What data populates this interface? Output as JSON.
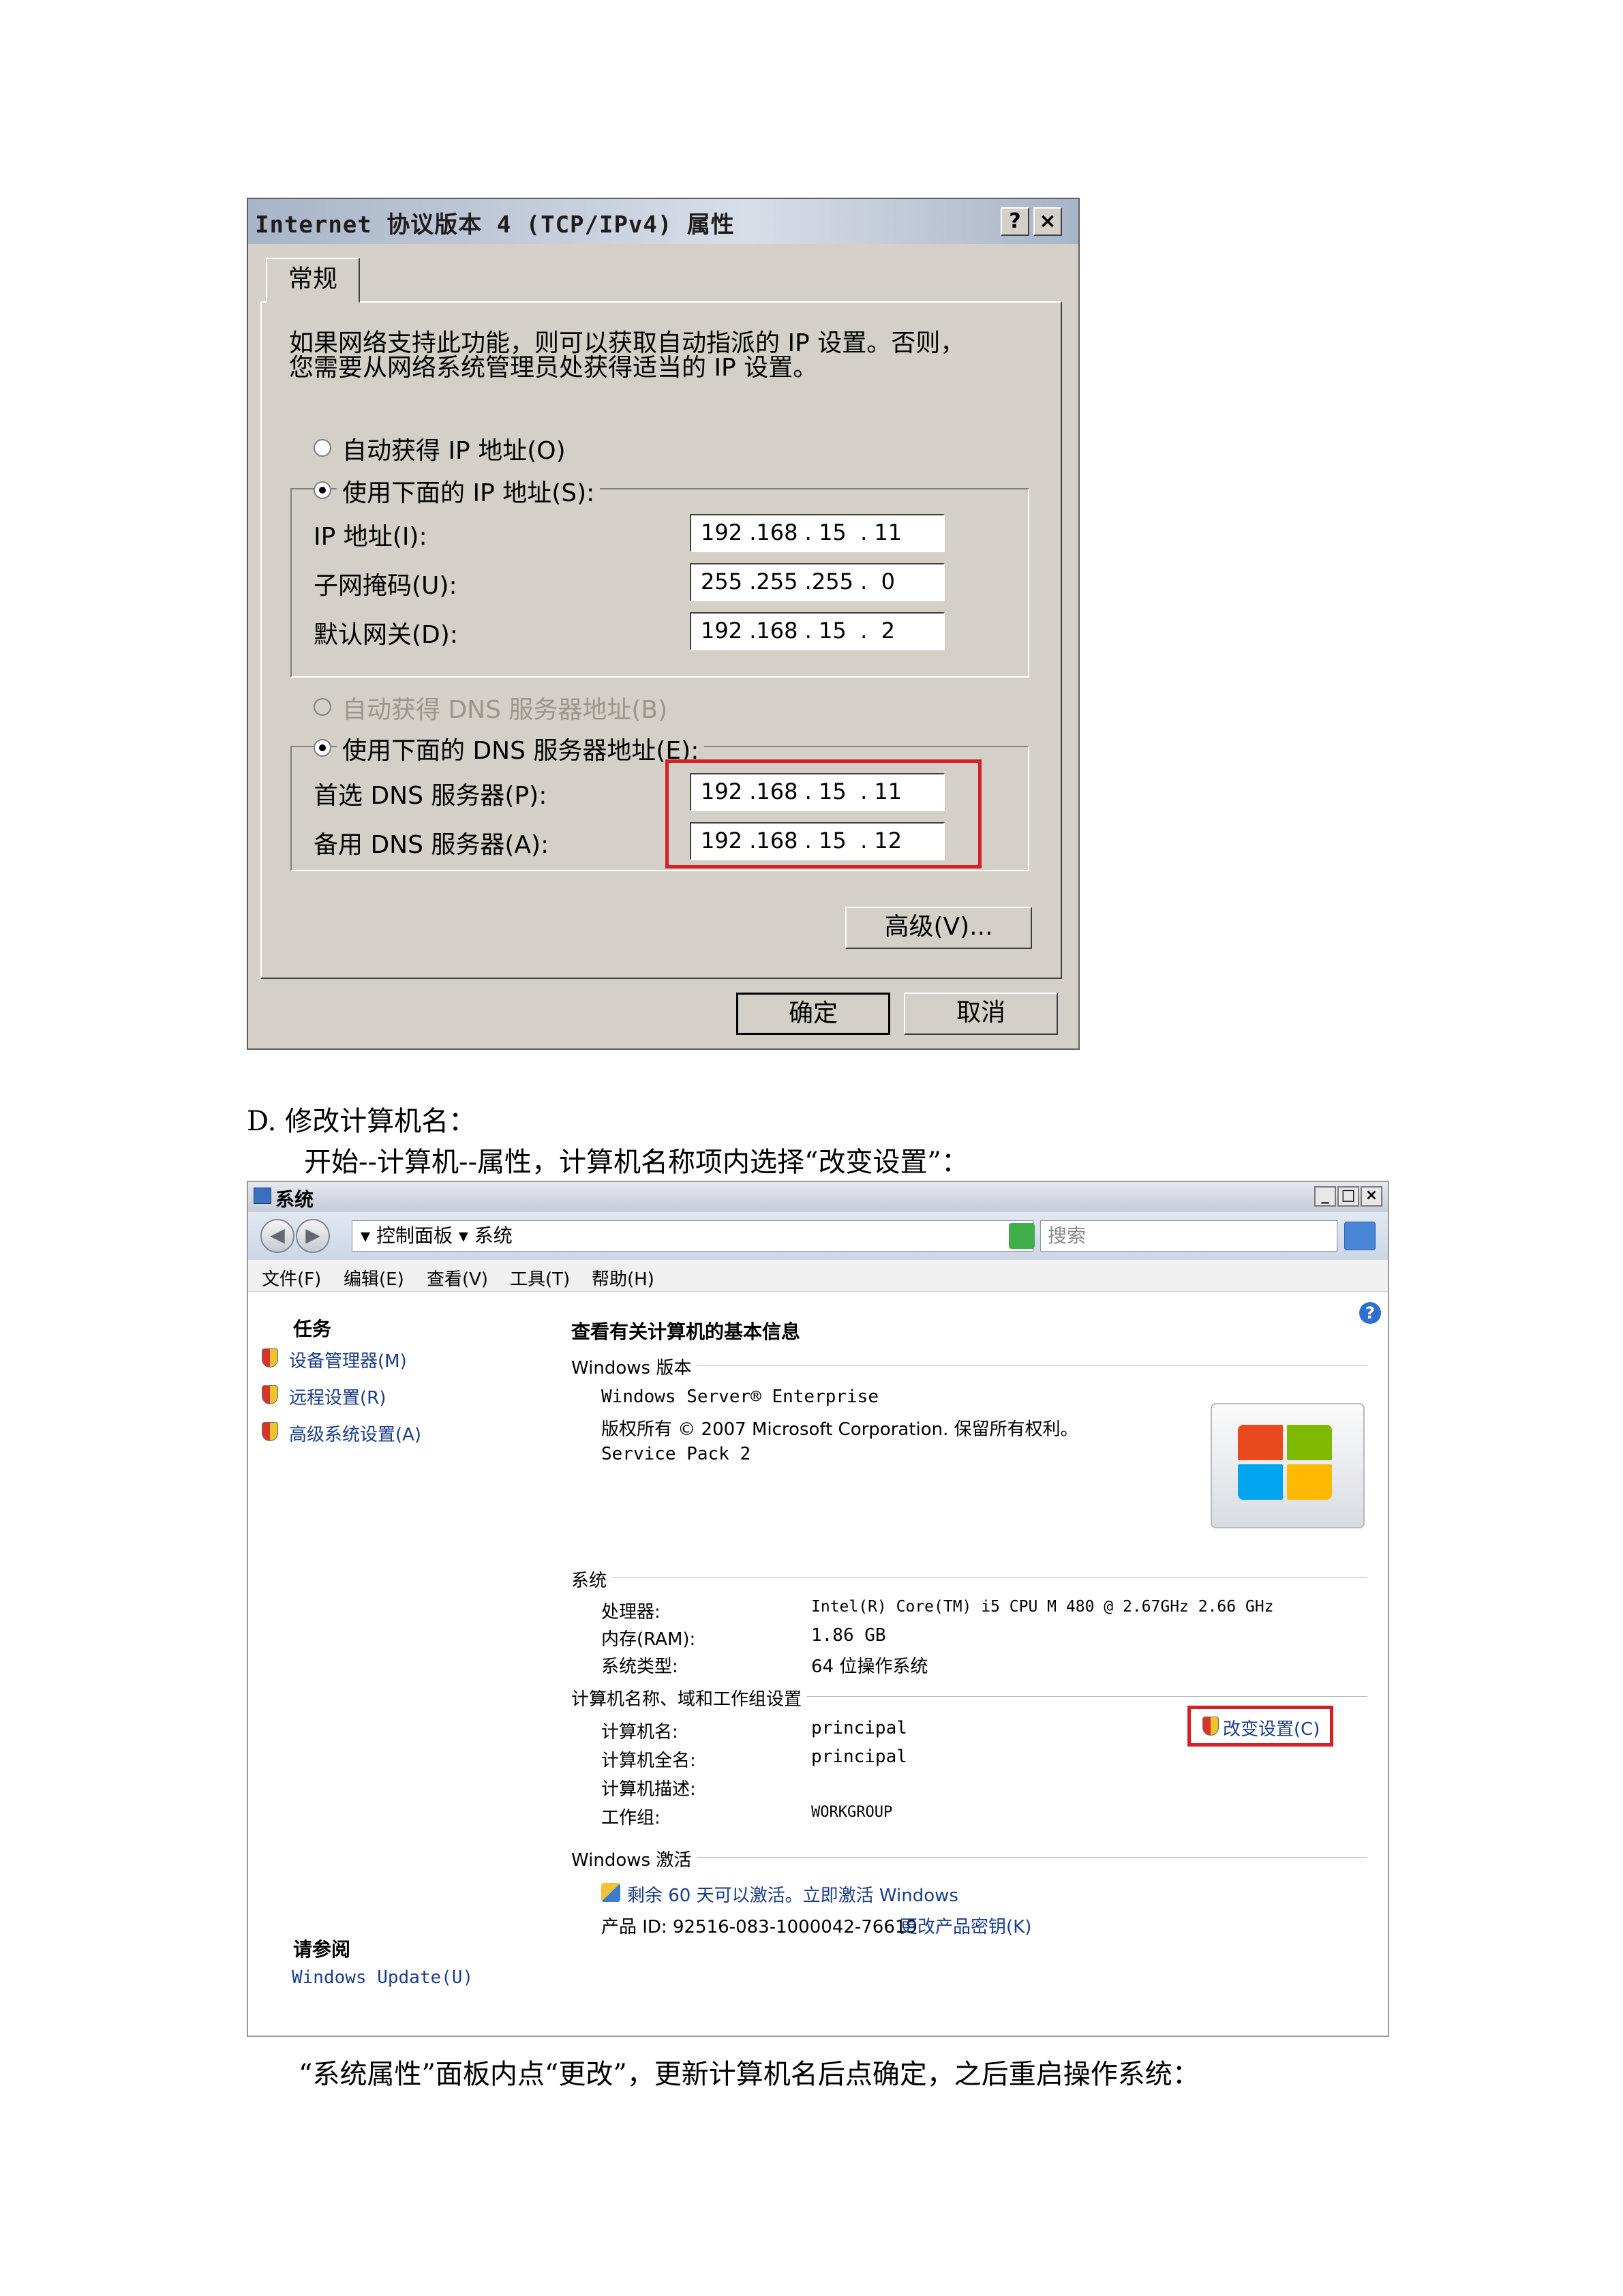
{
  "dialog1": {
    "title": "Internet 协议版本 4 (TCP/IPv4) 属性",
    "help_label": "?",
    "close_label": "×",
    "tab": "常规",
    "desc_line1": "如果网络支持此功能，则可以获取自动指派的 IP 设置。否则，",
    "desc_line2": "您需要从网络系统管理员处获得适当的 IP 设置。",
    "radio_auto_ip": "自动获得 IP 地址(O)",
    "radio_manual_ip": "使用下面的 IP 地址(S):",
    "ip_label": "IP 地址(I):",
    "ip_value": "192 .168 . 15  . 11",
    "mask_label": "子网掩码(U):",
    "mask_value": "255 .255 .255 .  0",
    "gateway_label": "默认网关(D):",
    "gateway_value": "192 .168 . 15  .  2",
    "radio_auto_dns": "自动获得 DNS 服务器地址(B)",
    "radio_manual_dns": "使用下面的 DNS 服务器地址(E):",
    "dns1_label": "首选 DNS 服务器(P):",
    "dns1_value": "192 .168 . 15  . 11",
    "dns2_label": "备用 DNS 服务器(A):",
    "dns2_value": "192 .168 . 15  . 12",
    "advanced_button": "高级(V)...",
    "ok_button": "确定",
    "cancel_button": "取消"
  },
  "doc": {
    "heading_d": "D.  修改计算机名：",
    "line_start": "开始--计算机--属性，计算机名称项内选择“改变设置”：",
    "line_end": "“系统属性”面板内点“更改”，更新计算机名后点确定，之后重启操作系统："
  },
  "window2": {
    "title": "系统",
    "min_label": "_",
    "max_label": "□",
    "close_label": "×",
    "back_label": "◀",
    "forward_label": "▶",
    "address": "▾ 控制面板 ▾ 系统",
    "search_placeholder": "搜索",
    "menus": [
      "文件(F)",
      "编辑(E)",
      "查看(V)",
      "工具(T)",
      "帮助(H)"
    ],
    "tasks_title": "任务",
    "tasks": [
      "设备管理器(M)",
      "远程设置(R)",
      "高级系统设置(A)"
    ],
    "see_also_title": "请参阅",
    "see_also_link": "Windows Update(U)",
    "help_label": "?",
    "main_title": "查看有关计算机的基本信息",
    "edition_section": "Windows 版本",
    "edition_name": "Windows Server® Enterprise",
    "copyright": "版权所有 © 2007 Microsoft Corporation. 保留所有权利。",
    "service_pack": "Service Pack 2",
    "system_section": "系统",
    "processor_label": "处理器:",
    "processor_value": "Intel(R) Core(TM) i5 CPU       M 480  @ 2.67GHz   2.66 GHz",
    "memory_label": "内存(RAM):",
    "memory_value": "1.86 GB",
    "type_label": "系统类型:",
    "type_value": "64 位操作系统",
    "name_section": "计算机名称、域和工作组设置",
    "comp_name_label": "计算机名:",
    "comp_name_value": "principal",
    "full_name_label": "计算机全名:",
    "full_name_value": "principal",
    "desc_label": "计算机描述:",
    "workgroup_label": "工作组:",
    "workgroup_value": "WORKGROUP",
    "change_settings": "改变设置(C)",
    "activation_section": "Windows 激活",
    "activation_text": "剩余 60 天可以激活。立即激活 Windows",
    "product_id": "产品 ID: 92516-083-1000042-76619",
    "change_key": "更改产品密钥(K)"
  },
  "colors": {
    "highlight_red": "#d42027",
    "dialog_gray": "#d4d0c8",
    "link_blue": "#1a3c8a"
  }
}
